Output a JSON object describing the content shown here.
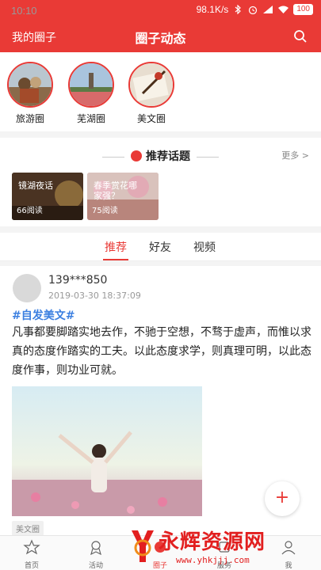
{
  "status_bar": {
    "time": "10:10",
    "speed": "98.1K/s",
    "battery": "100"
  },
  "header": {
    "left_label": "我的圈子",
    "title": "圈子动态"
  },
  "circles": [
    {
      "label": "旅游圈"
    },
    {
      "label": "芜湖圈"
    },
    {
      "label": "美文圈"
    }
  ],
  "topics": {
    "title": "推荐话题",
    "more_label": "更多 >",
    "cards": [
      {
        "title": "镜湖夜话",
        "reads": "66阅读"
      },
      {
        "title": "春季赏花哪家强？",
        "reads": "75阅读"
      }
    ]
  },
  "tabs": [
    "推荐",
    "好友",
    "视频"
  ],
  "post": {
    "username": "139***850",
    "timestamp": "2019-03-30 18:37:09",
    "hashtag": "#自发美文#",
    "content": "凡事都要脚踏实地去作，不驰于空想，不骛于虚声，而惟以求真的态度作踏实的工夫。以此态度求学，则真理可明，以此态度作事，则功业可就。",
    "tag": "美文圈"
  },
  "fab": {
    "label": "+"
  },
  "bottom_nav": [
    {
      "label": "首页",
      "icon": "star-icon"
    },
    {
      "label": "活动",
      "icon": "badge-icon"
    },
    {
      "label": "圈子",
      "icon": "circle-icon"
    },
    {
      "label": "服务",
      "icon": "service-icon"
    },
    {
      "label": "我",
      "icon": "user-icon"
    }
  ],
  "watermark": {
    "brand": "永辉资源网",
    "url": "www.yhkjjj.com"
  },
  "colors": {
    "accent": "#e93a36",
    "link": "#3b7fe0"
  }
}
